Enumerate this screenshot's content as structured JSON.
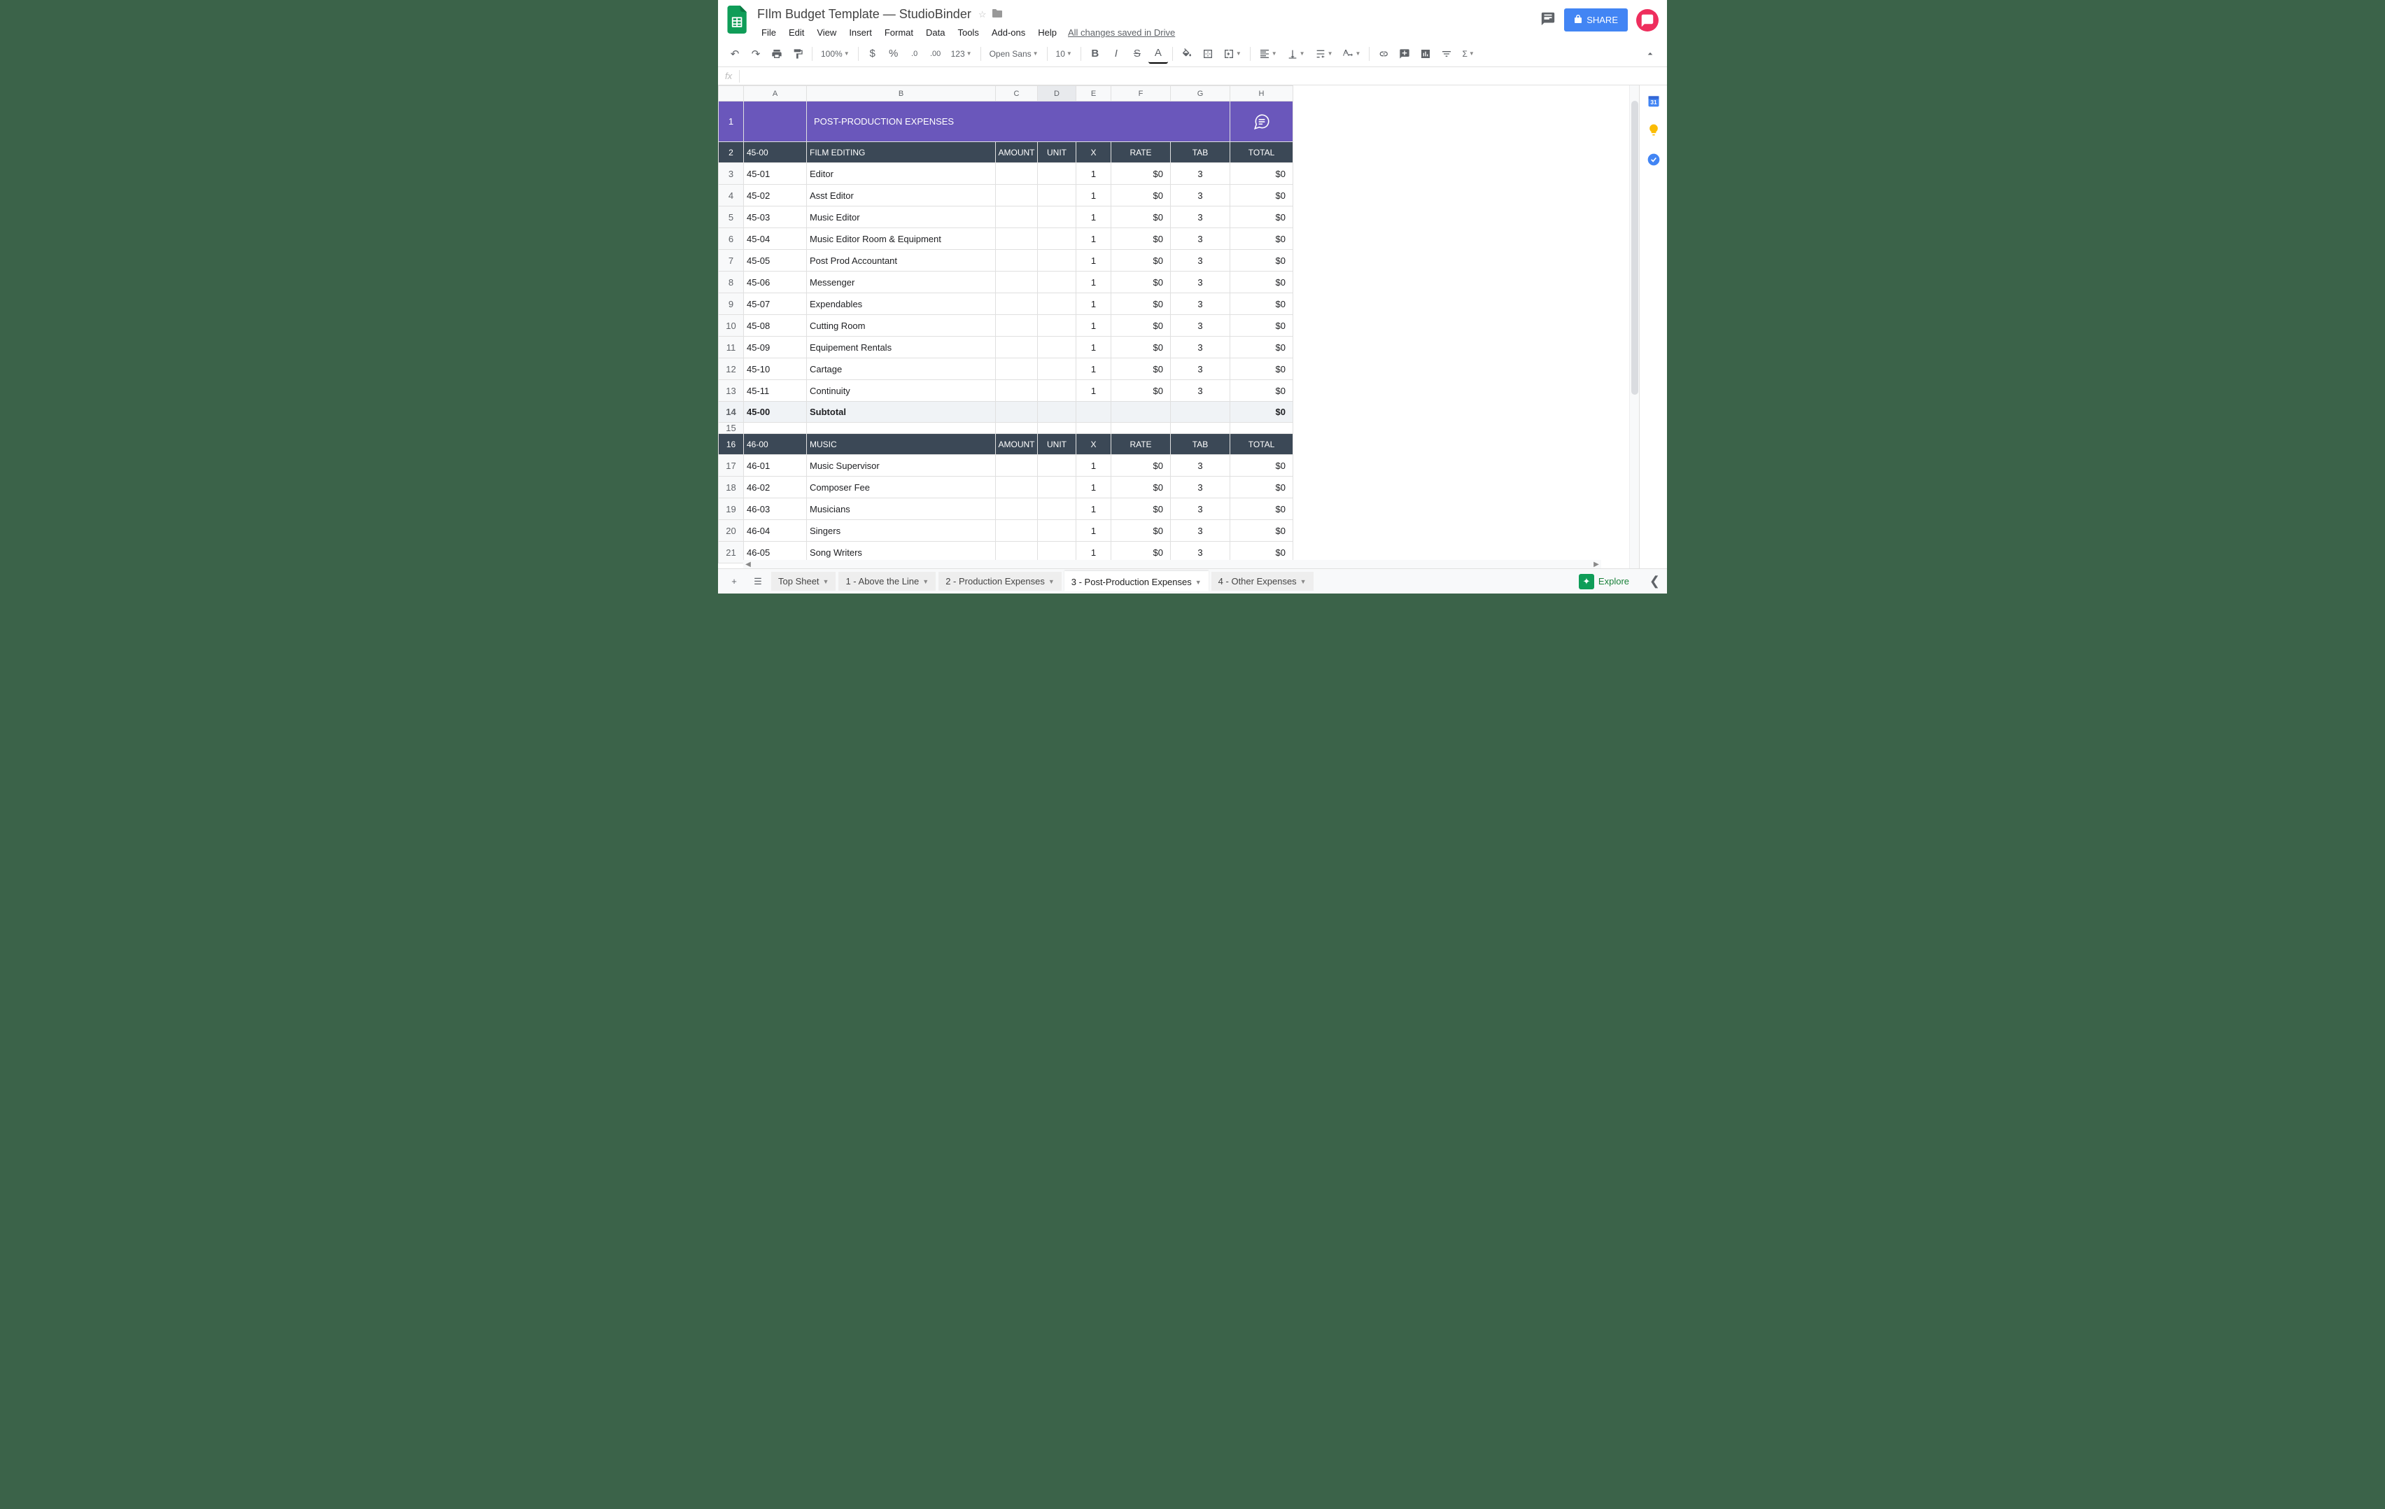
{
  "doc": {
    "title": "FIlm Budget Template — StudioBinder"
  },
  "menu": {
    "file": "File",
    "edit": "Edit",
    "view": "View",
    "insert": "Insert",
    "format": "Format",
    "data": "Data",
    "tools": "Tools",
    "addons": "Add-ons",
    "help": "Help",
    "save_status": "All changes saved in Drive"
  },
  "share": {
    "label": "SHARE"
  },
  "toolbar": {
    "zoom": "100%",
    "font": "Open Sans",
    "size": "10",
    "currency": "$",
    "percent": "%",
    "dec_less": ".0",
    "dec_more": ".00",
    "numfmt": "123"
  },
  "formula": {
    "fx": "fx"
  },
  "columns": [
    "A",
    "B",
    "C",
    "D",
    "E",
    "F",
    "G",
    "H"
  ],
  "sheet": {
    "title": "POST-PRODUCTION EXPENSES",
    "sections": [
      {
        "code": "45-00",
        "name": "FILM EDITING",
        "headers": {
          "amount": "AMOUNT",
          "unit": "UNIT",
          "x": "X",
          "rate": "RATE",
          "tab": "TAB",
          "total": "TOTAL"
        },
        "rows": [
          {
            "num": 3,
            "code": "45-01",
            "desc": "Editor",
            "x": "1",
            "rate": "$0",
            "tab": "3",
            "total": "$0"
          },
          {
            "num": 4,
            "code": "45-02",
            "desc": "Asst Editor",
            "x": "1",
            "rate": "$0",
            "tab": "3",
            "total": "$0"
          },
          {
            "num": 5,
            "code": "45-03",
            "desc": "Music Editor",
            "x": "1",
            "rate": "$0",
            "tab": "3",
            "total": "$0"
          },
          {
            "num": 6,
            "code": "45-04",
            "desc": "Music Editor Room & Equipment",
            "x": "1",
            "rate": "$0",
            "tab": "3",
            "total": "$0"
          },
          {
            "num": 7,
            "code": "45-05",
            "desc": "Post Prod Accountant",
            "x": "1",
            "rate": "$0",
            "tab": "3",
            "total": "$0"
          },
          {
            "num": 8,
            "code": "45-06",
            "desc": "Messenger",
            "x": "1",
            "rate": "$0",
            "tab": "3",
            "total": "$0"
          },
          {
            "num": 9,
            "code": "45-07",
            "desc": "Expendables",
            "x": "1",
            "rate": "$0",
            "tab": "3",
            "total": "$0"
          },
          {
            "num": 10,
            "code": "45-08",
            "desc": "Cutting Room",
            "x": "1",
            "rate": "$0",
            "tab": "3",
            "total": "$0"
          },
          {
            "num": 11,
            "code": "45-09",
            "desc": "Equipement Rentals",
            "x": "1",
            "rate": "$0",
            "tab": "3",
            "total": "$0"
          },
          {
            "num": 12,
            "code": "45-10",
            "desc": "Cartage",
            "x": "1",
            "rate": "$0",
            "tab": "3",
            "total": "$0"
          },
          {
            "num": 13,
            "code": "45-11",
            "desc": "Continuity",
            "x": "1",
            "rate": "$0",
            "tab": "3",
            "total": "$0"
          }
        ],
        "subtotal": {
          "num": 14,
          "code": "45-00",
          "label": "Subtotal",
          "total": "$0"
        }
      },
      {
        "code": "46-00",
        "name": "MUSIC",
        "headers": {
          "amount": "AMOUNT",
          "unit": "UNIT",
          "x": "X",
          "rate": "RATE",
          "tab": "TAB",
          "total": "TOTAL"
        },
        "rows": [
          {
            "num": 17,
            "code": "46-01",
            "desc": "Music Supervisor",
            "x": "1",
            "rate": "$0",
            "tab": "3",
            "total": "$0"
          },
          {
            "num": 18,
            "code": "46-02",
            "desc": "Composer Fee",
            "x": "1",
            "rate": "$0",
            "tab": "3",
            "total": "$0"
          },
          {
            "num": 19,
            "code": "46-03",
            "desc": "Musicians",
            "x": "1",
            "rate": "$0",
            "tab": "3",
            "total": "$0"
          },
          {
            "num": 20,
            "code": "46-04",
            "desc": "Singers",
            "x": "1",
            "rate": "$0",
            "tab": "3",
            "total": "$0"
          },
          {
            "num": 21,
            "code": "46-05",
            "desc": "Song Writers",
            "x": "1",
            "rate": "$0",
            "tab": "3",
            "total": "$0"
          }
        ]
      }
    ]
  },
  "tabs": {
    "topsheet": "Top Sheet",
    "t1": "1 - Above the Line",
    "t2": "2 - Production Expenses",
    "t3": "3 - Post-Production Expenses",
    "t4": "4 - Other Expenses"
  },
  "explore": {
    "label": "Explore"
  }
}
